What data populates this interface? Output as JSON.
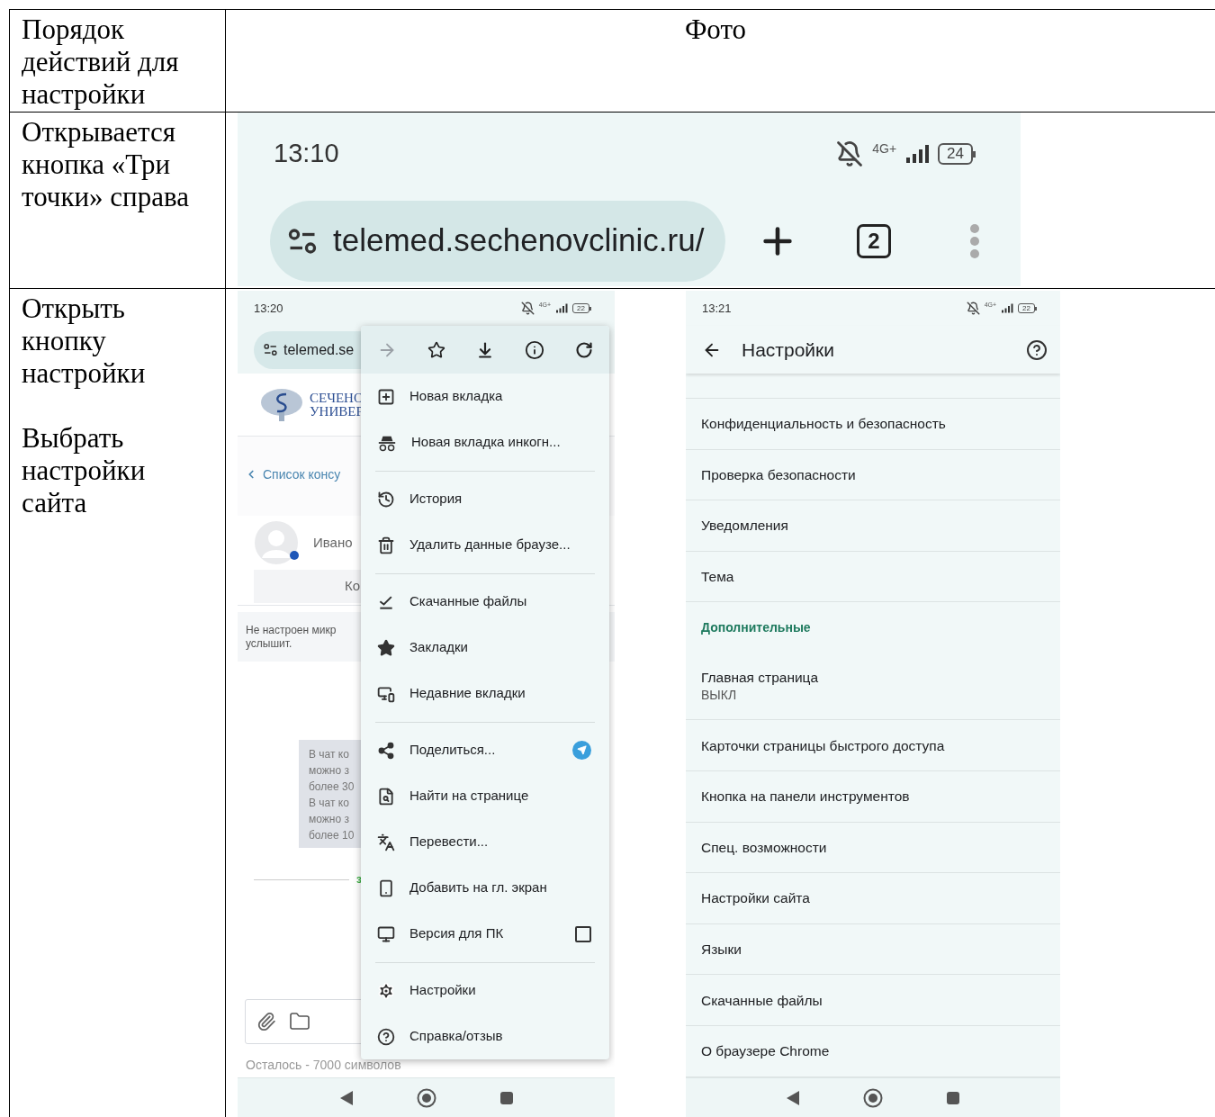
{
  "header": {
    "steps": "Порядок действий для настройки",
    "photo": "Фото"
  },
  "row_1": {
    "steps": [
      "Открывается кнопка «Три точки» справа"
    ],
    "phone": {
      "time": "13:10",
      "network": "4G+",
      "battery": "24",
      "url": "telemed.sechenovclinic.ru/",
      "tab_count": "2"
    }
  },
  "row_2": {
    "steps": [
      "Открыть кнопку настройки",
      "Выбрать настройки сайта"
    ],
    "menu_screen": {
      "time": "13:20",
      "network": "4G+",
      "battery": "22",
      "url": "telemed.se",
      "page": {
        "logo_lines": [
          "СЕЧЕНО",
          "УНИВЕР"
        ],
        "back_link": "Список консу",
        "user": "Ивано",
        "button": "Ко",
        "notice_lines": [
          "Не настроен микр",
          "услышит."
        ],
        "bubble_lines": [
          "В чат ко",
          "можно з",
          "более 30",
          "В чат ко",
          "можно з",
          "более 10"
        ],
        "divider_label": "з",
        "remaining": "Осталось - 7000 символов"
      },
      "menu": {
        "toolbar": [
          {
            "disabled": true
          },
          {
            "disabled": false
          },
          {
            "disabled": false
          },
          {
            "disabled": false
          },
          {
            "disabled": false
          }
        ],
        "items": [
          {
            "kind": "item",
            "label": "Новая вкладка"
          },
          {
            "kind": "item",
            "label": "Новая вкладка инкогн..."
          },
          {
            "kind": "divider"
          },
          {
            "kind": "item",
            "label": "История"
          },
          {
            "kind": "item",
            "label": "Удалить данные браузе..."
          },
          {
            "kind": "divider"
          },
          {
            "kind": "item",
            "label": "Скачанные файлы"
          },
          {
            "kind": "item",
            "label": "Закладки"
          },
          {
            "kind": "item",
            "label": "Недавние вкладки"
          },
          {
            "kind": "divider"
          },
          {
            "kind": "share",
            "label": "Поделиться..."
          },
          {
            "kind": "item",
            "label": "Найти на странице"
          },
          {
            "kind": "item",
            "label": "Перевести..."
          },
          {
            "kind": "item",
            "label": "Добавить на гл. экран"
          },
          {
            "kind": "checkbox",
            "label": "Версия для ПК",
            "checked": false
          },
          {
            "kind": "divider"
          },
          {
            "kind": "item",
            "label": "Настройки"
          },
          {
            "kind": "item",
            "label": "Справка/отзыв"
          }
        ]
      }
    },
    "settings_screen": {
      "time": "13:21",
      "network": "4G+",
      "battery": "22",
      "title": "Настройки",
      "items": [
        {
          "kind": "item",
          "label": "Конфиденциальность и безопасность"
        },
        {
          "kind": "item",
          "label": "Проверка безопасности"
        },
        {
          "kind": "item",
          "label": "Уведомления"
        },
        {
          "kind": "item",
          "label": "Тема"
        },
        {
          "kind": "section",
          "label": "Дополнительные"
        },
        {
          "kind": "item",
          "label": "Главная страница",
          "subtitle": "ВЫКЛ"
        },
        {
          "kind": "item",
          "label": "Карточки страницы быстрого доступа"
        },
        {
          "kind": "item",
          "label": "Кнопка на панели инструментов"
        },
        {
          "kind": "item",
          "label": "Спец. возможности"
        },
        {
          "kind": "item",
          "label": "Настройки сайта"
        },
        {
          "kind": "item",
          "label": "Языки"
        },
        {
          "kind": "item",
          "label": "Скачанные файлы"
        },
        {
          "kind": "item",
          "label": "О браузере Chrome"
        }
      ]
    }
  }
}
